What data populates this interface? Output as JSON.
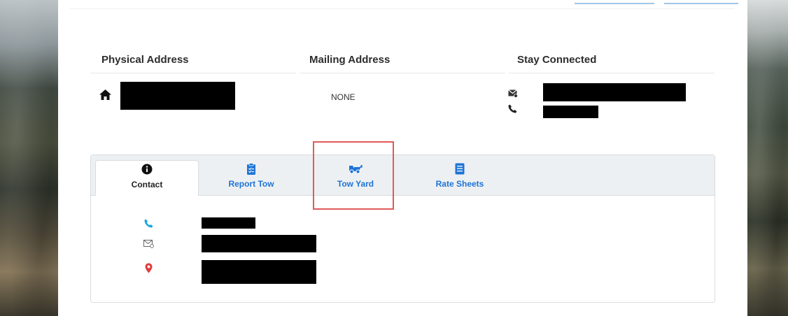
{
  "columns": {
    "physical": {
      "title": "Physical Address"
    },
    "mailing": {
      "title": "Mailing Address",
      "value": "NONE"
    },
    "connected": {
      "title": "Stay Connected"
    }
  },
  "tabs": [
    {
      "label": "Contact",
      "icon": "info-circle-icon",
      "active": true
    },
    {
      "label": "Report Tow",
      "icon": "clipboard-icon",
      "active": false
    },
    {
      "label": "Tow Yard",
      "icon": "tow-truck-icon",
      "active": false
    },
    {
      "label": "Rate Sheets",
      "icon": "document-list-icon",
      "active": false
    }
  ],
  "colors": {
    "accent": "#1e74d6",
    "phone": "#1aa3e0",
    "location": "#e23b3b",
    "highlight": "#e05a5a"
  }
}
